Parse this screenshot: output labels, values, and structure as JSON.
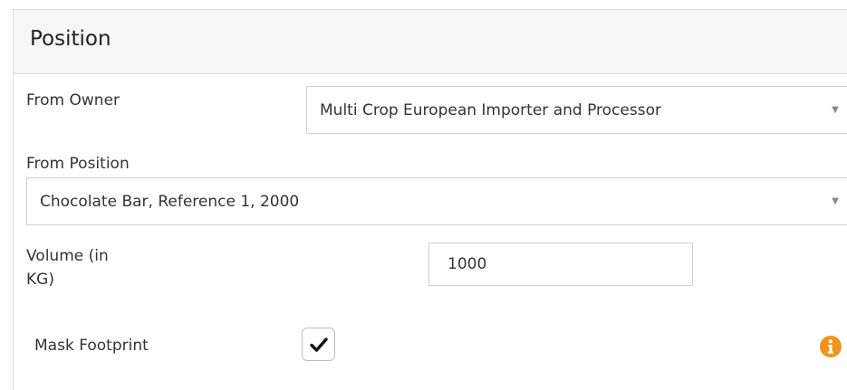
{
  "panel": {
    "title": "Position"
  },
  "from_owner": {
    "label": "From Owner",
    "value": "Multi Crop European Importer and Processor"
  },
  "from_position": {
    "label": "From Position",
    "value": "Chocolate Bar, Reference 1, 2000"
  },
  "volume": {
    "label_line1": "Volume (in",
    "label_line2": "KG)",
    "value": "1000"
  },
  "mask_footprint": {
    "label": "Mask Footprint",
    "checked": true
  },
  "icons": {
    "dropdown": "chevron-down-icon",
    "checkbox_mark": "checkmark-icon",
    "info": "info-icon"
  },
  "colors": {
    "header_bg": "#f6f6f6",
    "info_icon": "#f0931e",
    "border": "#cfcfcf"
  }
}
